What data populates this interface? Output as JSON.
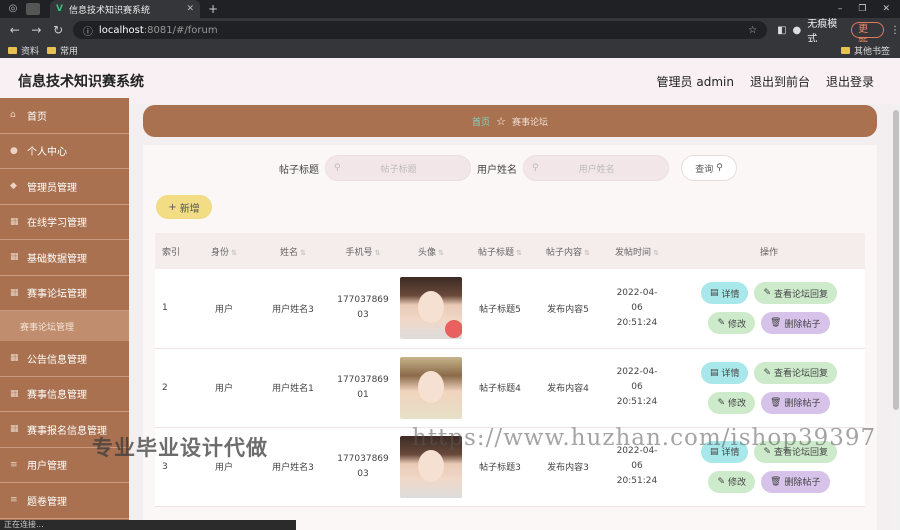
{
  "browser": {
    "tab_title": "信息技术知识赛系统",
    "url_host": "localhost",
    "url_path": ":8081/#/forum",
    "incognito_label": "无痕模式",
    "update_label": "更新",
    "bookmarks": [
      "资料",
      "常用"
    ],
    "bookmarks_right": "其他书签",
    "status_text": "正在连接..."
  },
  "header": {
    "app_title": "信息技术知识赛系统",
    "user_label": "管理员 admin",
    "front_label": "退出到前台",
    "logout_label": "退出登录"
  },
  "sidebar": {
    "items": [
      {
        "label": "首页",
        "icon": "home-icon"
      },
      {
        "label": "个人中心",
        "icon": "user-icon"
      },
      {
        "label": "管理员管理",
        "icon": "admin-icon"
      },
      {
        "label": "在线学习管理",
        "icon": "grid-icon"
      },
      {
        "label": "基础数据管理",
        "icon": "grid-icon"
      },
      {
        "label": "赛事论坛管理",
        "icon": "grid-icon"
      },
      {
        "label": "公告信息管理",
        "icon": "grid-icon"
      },
      {
        "label": "赛事信息管理",
        "icon": "grid-icon"
      },
      {
        "label": "赛事报名信息管理",
        "icon": "grid-icon"
      },
      {
        "label": "用户管理",
        "icon": "list-icon"
      },
      {
        "label": "题卷管理",
        "icon": "list-icon"
      }
    ],
    "active_sub": "赛事论坛管理"
  },
  "breadcrumb": {
    "home": "首页",
    "current": "赛事论坛"
  },
  "search": {
    "title_label": "帖子标题",
    "title_placeholder": "帖子标题",
    "user_label": "用户姓名",
    "user_placeholder": "用户姓名",
    "button_label": "查询"
  },
  "add_label": "新增",
  "table": {
    "headers": [
      "索引",
      "身份",
      "姓名",
      "手机号",
      "头像",
      "帖子标题",
      "帖子内容",
      "发帖时间",
      "操作"
    ],
    "rows": [
      {
        "index": "1",
        "identity": "用户",
        "name": "用户姓名3",
        "phone": "17703786903",
        "title": "帖子标题5",
        "content": "发布内容5",
        "time": "2022-04-06 20:51:24"
      },
      {
        "index": "2",
        "identity": "用户",
        "name": "用户姓名1",
        "phone": "17703786901",
        "title": "帖子标题4",
        "content": "发布内容4",
        "time": "2022-04-06 20:51:24"
      },
      {
        "index": "3",
        "identity": "用户",
        "name": "用户姓名3",
        "phone": "17703786903",
        "title": "帖子标题3",
        "content": "发布内容3",
        "time": "2022-04-06 20:51:24"
      }
    ],
    "ops": {
      "detail": "详情",
      "reply": "查看论坛回复",
      "edit": "修改",
      "delete": "删除帖子"
    }
  },
  "watermark_left": "专业毕业设计代做",
  "watermark_right": "https://www.huzhan.com/ishop39397"
}
